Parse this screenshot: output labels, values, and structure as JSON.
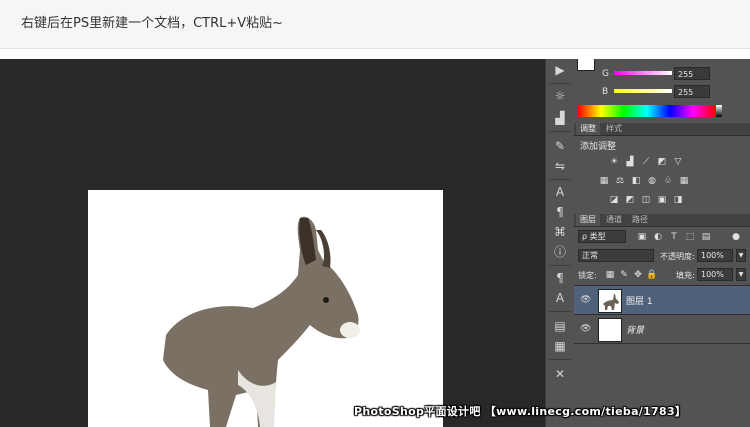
{
  "caption": "右键后在PS里新建一个文档，CTRL+V粘贴~",
  "color_panel": {
    "channels": [
      {
        "label": "G",
        "value": "255"
      },
      {
        "label": "B",
        "value": "255"
      }
    ]
  },
  "adjust_panel": {
    "tabs": [
      "调整",
      "样式"
    ],
    "title": "添加调整"
  },
  "layers_panel": {
    "tabs": [
      "图层",
      "通道",
      "路径"
    ],
    "kind_filter": "ρ 类型",
    "blend_mode": "正常",
    "opacity_label": "不透明度:",
    "opacity_value": "100%",
    "lock_label": "锁定:",
    "fill_label": "填充:",
    "fill_value": "100%",
    "layers": [
      {
        "name": "图层 1",
        "selected": true
      },
      {
        "name": "背景",
        "selected": false
      }
    ]
  },
  "watermark": "PhotoShop平面设计吧 【www.linecg.com/tieba/1783】"
}
